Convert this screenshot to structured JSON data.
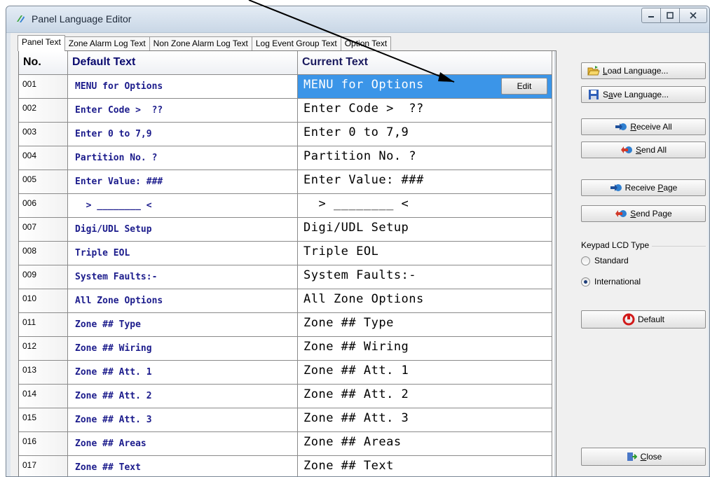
{
  "window": {
    "title": "Panel Language Editor",
    "icon": "app-logo-icon"
  },
  "tabs": [
    {
      "label": "Panel Text",
      "active": true
    },
    {
      "label": "Zone Alarm Log Text",
      "active": false
    },
    {
      "label": "Non Zone Alarm Log Text",
      "active": false
    },
    {
      "label": "Log Event Group Text",
      "active": false
    },
    {
      "label": "Option Text",
      "active": false
    }
  ],
  "grid": {
    "headers": {
      "no": "No.",
      "default": "Default Text",
      "current": "Current Text"
    },
    "edit_label": "Edit",
    "rows": [
      {
        "no": "001",
        "default": "MENU for Options",
        "current": "MENU for Options"
      },
      {
        "no": "002",
        "default": "Enter Code >  ??",
        "current": "Enter Code >  ??"
      },
      {
        "no": "003",
        "default": "Enter 0 to 7,9",
        "current": "Enter 0 to 7,9"
      },
      {
        "no": "004",
        "default": "Partition No. ?",
        "current": "Partition No. ?"
      },
      {
        "no": "005",
        "default": "Enter Value: ###",
        "current": "Enter Value: ###"
      },
      {
        "no": "006",
        "default": "  > ________ <",
        "current": "  > ________ <"
      },
      {
        "no": "007",
        "default": "Digi/UDL Setup",
        "current": "Digi/UDL Setup"
      },
      {
        "no": "008",
        "default": "Triple EOL",
        "current": "Triple EOL"
      },
      {
        "no": "009",
        "default": "System Faults:-",
        "current": "System Faults:-"
      },
      {
        "no": "010",
        "default": "All Zone Options",
        "current": "All Zone Options"
      },
      {
        "no": "011",
        "default": "Zone ## Type",
        "current": "Zone ## Type"
      },
      {
        "no": "012",
        "default": "Zone ## Wiring",
        "current": "Zone ## Wiring"
      },
      {
        "no": "013",
        "default": "Zone ## Att. 1",
        "current": "Zone ## Att. 1"
      },
      {
        "no": "014",
        "default": "Zone ## Att. 2",
        "current": "Zone ## Att. 2"
      },
      {
        "no": "015",
        "default": "Zone ## Att. 3",
        "current": "Zone ## Att. 3"
      },
      {
        "no": "016",
        "default": "Zone ## Areas",
        "current": "Zone ## Areas"
      },
      {
        "no": "017",
        "default": "Zone ## Text",
        "current": "Zone ## Text"
      }
    ]
  },
  "side": {
    "load_language": {
      "pre": "",
      "key": "L",
      "post": "oad Language..."
    },
    "save_language": {
      "pre": "S",
      "key": "a",
      "post": "ve Language..."
    },
    "receive_all": {
      "pre": "",
      "key": "R",
      "post": "eceive All"
    },
    "send_all": {
      "pre": "",
      "key": "S",
      "post": "end All"
    },
    "receive_page": {
      "pre": "Receive ",
      "key": "P",
      "post": "age"
    },
    "send_page": {
      "pre": "",
      "key": "S",
      "post": "end Page"
    },
    "lcd_type_label": "Keypad LCD Type",
    "lcd_options": [
      "Standard",
      "International"
    ],
    "lcd_selected": "International",
    "default_label": "Default",
    "close": {
      "pre": "",
      "key": "C",
      "post": "lose"
    }
  },
  "colors": {
    "selection": "#3b95e8",
    "default_text": "#1c1c8c",
    "window_frame": "#dfe6ee"
  }
}
